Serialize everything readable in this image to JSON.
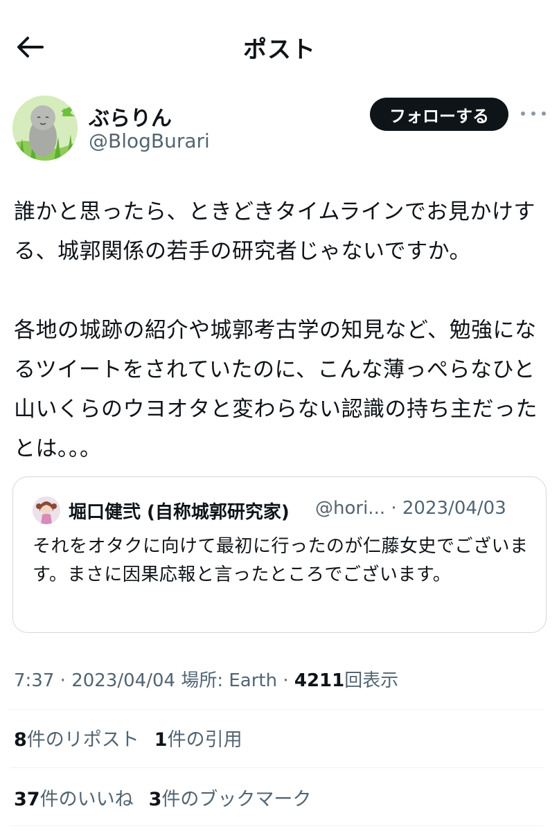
{
  "header": {
    "title": "ポスト"
  },
  "author": {
    "display_name": "ぶらりん",
    "handle": "@BlogBurari",
    "follow_label": "フォローする"
  },
  "post": {
    "text": "誰かと思ったら、ときどきタイムラインでお見かけする、城郭関係の若手の研究者じゃないですか。\n\n各地の城跡の紹介や城郭考古学の知見など、勉強になるツイートをされていたのに、こんな薄っぺらなひと山いくらのウヨオタと変わらない認識の持ち主だったとは。。。",
    "time": "7:37",
    "date": "2023/04/04",
    "location_label": "場所: Earth",
    "views": "4211",
    "views_label": "回表示",
    "separator": "·"
  },
  "quote": {
    "display_name": "堀口健弐 (自称城郭研究家)",
    "handle": "@hori...",
    "separator": "·",
    "date": "2023/04/03",
    "text": "それをオタクに向けて最初に行ったのが仁藤女史でございます。まさに因果応報と言ったところでございます。"
  },
  "stats": {
    "reposts_count": "8",
    "reposts_label": "件のリポスト",
    "quotes_count": "1",
    "quotes_label": "件の引用",
    "likes_count": "37",
    "likes_label": "件のいいね",
    "bookmarks_count": "3",
    "bookmarks_label": "件のブックマーク"
  },
  "icons": {
    "back": "arrow-left-icon",
    "more": "more-horizontal-icon"
  },
  "colors": {
    "text": "#0f1419",
    "secondary": "#536471",
    "border": "#cfd9de",
    "follow_bg": "#0f1419"
  }
}
